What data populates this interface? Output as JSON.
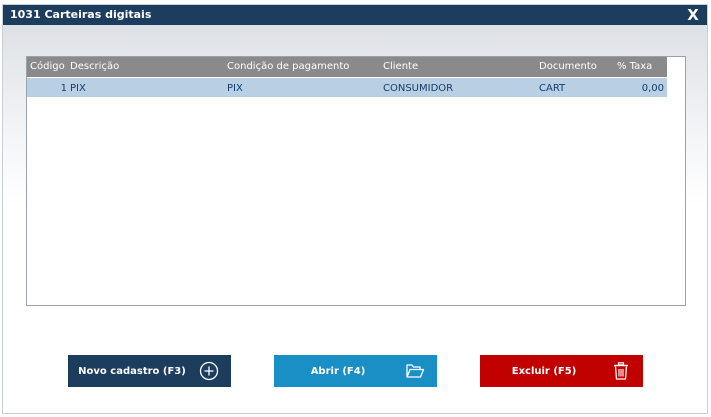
{
  "window": {
    "title": "1031 Carteiras digitais",
    "close_label": "X"
  },
  "grid": {
    "columns": {
      "codigo": "Código",
      "descricao": "Descrição",
      "condicao": "Condição de pagamento",
      "cliente": "Cliente",
      "documento": "Documento",
      "taxa": "% Taxa"
    },
    "rows": [
      {
        "codigo": "1",
        "descricao": "PIX",
        "condicao": "PIX",
        "cliente": "CONSUMIDOR",
        "documento": "CART",
        "taxa": "0,00"
      }
    ]
  },
  "buttons": {
    "novo": {
      "label": "Novo cadastro (F3)",
      "icon": "plus-circle-icon"
    },
    "abrir": {
      "label": "Abrir (F4)",
      "icon": "folder-open-icon"
    },
    "excluir": {
      "label": "Excluir (F5)",
      "icon": "trash-icon"
    }
  },
  "colors": {
    "titlebar": "#1d3d5e",
    "row_selected": "#b9cfe3",
    "novo_button": "#1d3d5e",
    "abrir_button": "#1a8fc5",
    "excluir_button": "#c10000"
  }
}
